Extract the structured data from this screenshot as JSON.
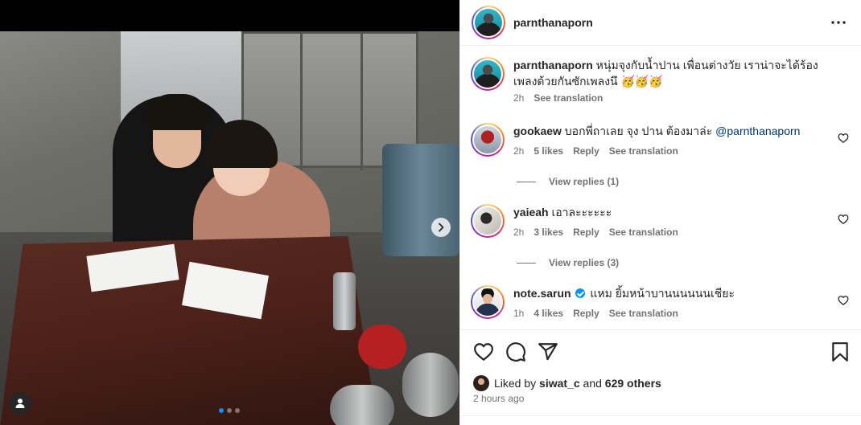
{
  "post": {
    "carousel_position": 1,
    "carousel_count": 3
  },
  "owner": {
    "username": "parnthanaporn",
    "caption": "หนุ่มจุงกับน้ำปาน เพื่อนต่างวัย เราน่าจะได้ร้องเพลงด้วยกันซักเพลงนึ 🥳🥳🥳",
    "caption_time": "2h",
    "see_translation": "See translation"
  },
  "comments": [
    {
      "username": "gookaew",
      "text": "บอกพี่ถาเลย จุง ปาน ต้องมาล่ะ ",
      "mention": "@parnthanaporn",
      "time": "2h",
      "likes": "5 likes",
      "reply": "Reply",
      "see_translation": "See translation",
      "view_replies": "View replies (1)"
    },
    {
      "username": "yaieah",
      "text": "เอาละะะะะะ",
      "mention": "",
      "time": "2h",
      "likes": "3 likes",
      "reply": "Reply",
      "see_translation": "See translation",
      "view_replies": "View replies (3)"
    },
    {
      "username": "note.sarun",
      "verified": true,
      "text": "แหม ยิ้มหน้าบานนนนนนเชียะ",
      "mention": "",
      "time": "1h",
      "likes": "4 likes",
      "reply": "Reply",
      "see_translation": "See translation"
    }
  ],
  "likes": {
    "prefix": "Liked by",
    "user": "siwat_c",
    "and": "and",
    "others": "629 others"
  },
  "timestamp": "2 hours ago",
  "icons": {
    "like": "heart-icon",
    "comment": "comment-icon",
    "share": "share-icon",
    "save": "bookmark-icon",
    "more": "more-icon",
    "next": "chevron-right-icon",
    "tags": "user-tag-icon"
  },
  "colors": {
    "link": "#00376b",
    "secondary_text": "#737373",
    "carousel_active": "#0095f6"
  }
}
